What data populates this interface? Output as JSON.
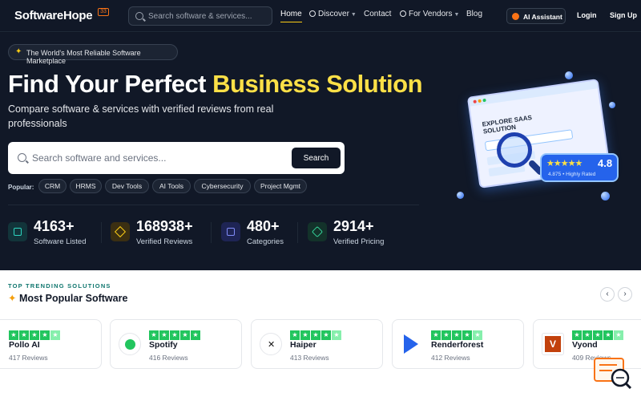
{
  "nav": {
    "logo": "SoftwareHope",
    "search_placeholder": "Search software & services...",
    "links": [
      "Home",
      "Discover",
      "Contact",
      "For Vendors",
      "Blog"
    ],
    "ai_label": "AI Assistant",
    "login": "Login",
    "signup": "Sign Up"
  },
  "hero": {
    "tagline": "The World's Most Reliable Software Marketplace",
    "title_a": "Find Your Perfect ",
    "title_b": "Business Solution",
    "subtitle": "Compare software & services with verified reviews from real professionals",
    "search_placeholder": "Search software and services...",
    "search_button": "Search",
    "popular_label": "Popular:",
    "chips": [
      "CRM",
      "HRMS",
      "Dev Tools",
      "AI Tools",
      "Cybersecurity",
      "Project Mgmt"
    ],
    "stats": [
      {
        "value": "4163+",
        "label": "Software Listed"
      },
      {
        "value": "168938+",
        "label": "Verified Reviews"
      },
      {
        "value": "480+",
        "label": "Categories"
      },
      {
        "value": "2914+",
        "label": "Verified Pricing"
      }
    ],
    "illustration": {
      "window_title": "EXPLORE SAAS SOLUTION",
      "rating_value": "4.8",
      "rating_caption": "4.875 • Highly Rated"
    }
  },
  "trending": {
    "kicker": "TOP TRENDING SOLUTIONS",
    "title": "Most Popular Software",
    "cards": [
      {
        "name": "Pollo AI",
        "reviews": "417 Reviews"
      },
      {
        "name": "Spotify",
        "reviews": "416 Reviews"
      },
      {
        "name": "Haiper",
        "reviews": "413 Reviews"
      },
      {
        "name": "Renderforest",
        "reviews": "412 Reviews"
      },
      {
        "name": "Vyond",
        "reviews": "409 Reviews"
      }
    ]
  },
  "colors": {
    "accent_yellow": "#fde047",
    "star_green": "#22c55e",
    "brand_dark": "#111827"
  }
}
